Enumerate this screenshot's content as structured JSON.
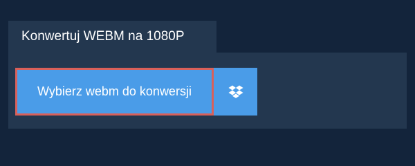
{
  "tab": {
    "title": "Konwertuj WEBM na 1080P"
  },
  "upload": {
    "select_label": "Wybierz webm do konwersji",
    "dropbox_icon": "dropbox-icon"
  },
  "colors": {
    "background": "#13243b",
    "panel": "#23374f",
    "button": "#4a9ce8",
    "focus_outline": "#d9605a",
    "text": "#ffffff"
  }
}
